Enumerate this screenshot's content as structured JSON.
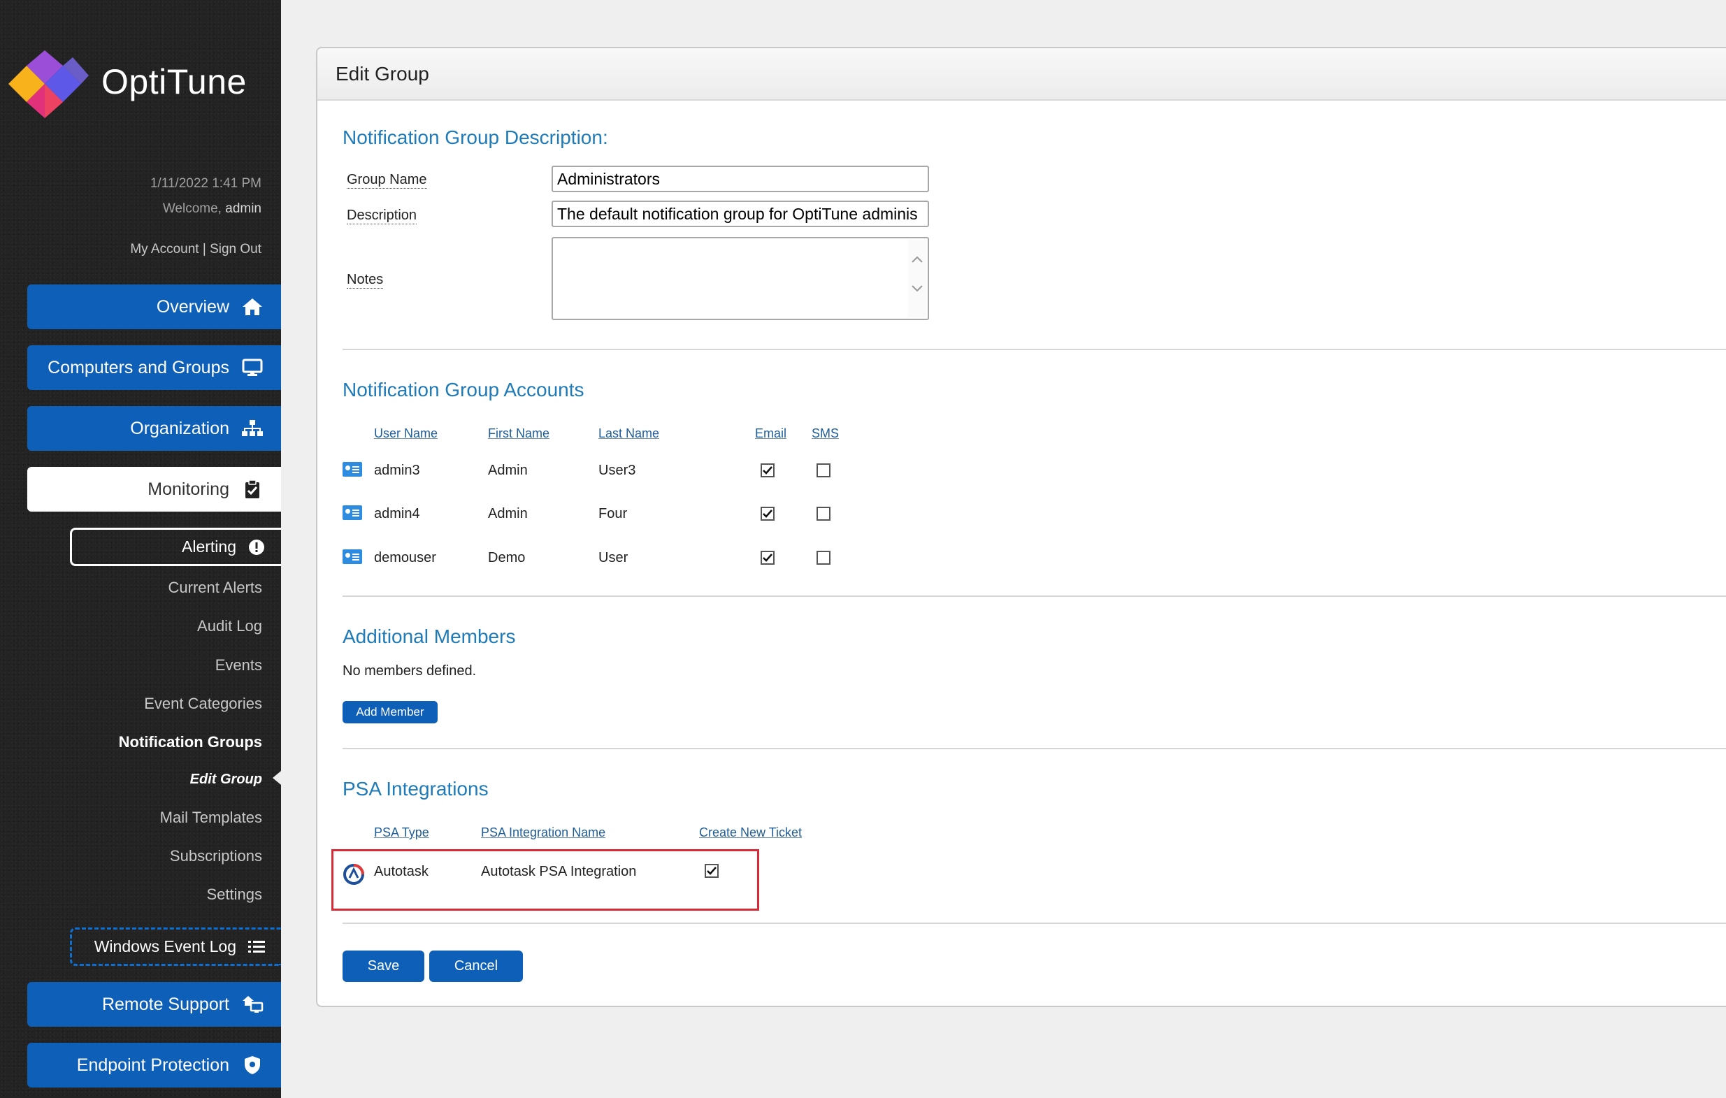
{
  "brand": {
    "name": "OptiTune"
  },
  "session": {
    "datetime": "1/11/2022 1:41 PM",
    "welcome_prefix": "Welcome,",
    "user": "admin",
    "my_account": "My Account",
    "separator": "|",
    "sign_out": "Sign Out"
  },
  "nav": {
    "overview": "Overview",
    "computers": "Computers and Groups",
    "organization": "Organization",
    "monitoring": "Monitoring",
    "alerting": "Alerting",
    "sub": {
      "current_alerts": "Current Alerts",
      "audit_log": "Audit Log",
      "events": "Events",
      "event_categories": "Event Categories",
      "notification_groups": "Notification Groups",
      "edit_group": "Edit Group",
      "mail_templates": "Mail Templates",
      "subscriptions": "Subscriptions",
      "settings": "Settings"
    },
    "windows_event_log": "Windows Event Log",
    "remote_support": "Remote Support",
    "endpoint_protection": "Endpoint Protection"
  },
  "panel": {
    "title": "Edit Group"
  },
  "description_section": {
    "title": "Notification Group Description:",
    "group_name_label": "Group Name",
    "group_name_value": "Administrators",
    "description_label": "Description",
    "description_value": "The default notification group for OptiTune adminis",
    "notes_label": "Notes",
    "notes_value": ""
  },
  "accounts_section": {
    "title": "Notification Group Accounts",
    "columns": {
      "user_name": "User Name",
      "first_name": "First Name",
      "last_name": "Last Name",
      "email": "Email",
      "sms": "SMS"
    },
    "rows": [
      {
        "user_name": "admin3",
        "first_name": "Admin",
        "last_name": "User3",
        "email": true,
        "sms": false
      },
      {
        "user_name": "admin4",
        "first_name": "Admin",
        "last_name": "Four",
        "email": true,
        "sms": false
      },
      {
        "user_name": "demouser",
        "first_name": "Demo",
        "last_name": "User",
        "email": true,
        "sms": false
      }
    ]
  },
  "members_section": {
    "title": "Additional Members",
    "empty_text": "No members defined.",
    "add_button": "Add Member"
  },
  "psa_section": {
    "title": "PSA Integrations",
    "columns": {
      "type": "PSA Type",
      "name": "PSA Integration Name",
      "ticket": "Create New Ticket"
    },
    "rows": [
      {
        "type": "Autotask",
        "name": "Autotask PSA Integration",
        "create_ticket": true
      }
    ]
  },
  "actions": {
    "save": "Save",
    "cancel": "Cancel"
  },
  "colors": {
    "primary": "#0e5fb7",
    "heading": "#1f7ab8",
    "highlight": "#d62a36",
    "sidebar": "#232323"
  }
}
